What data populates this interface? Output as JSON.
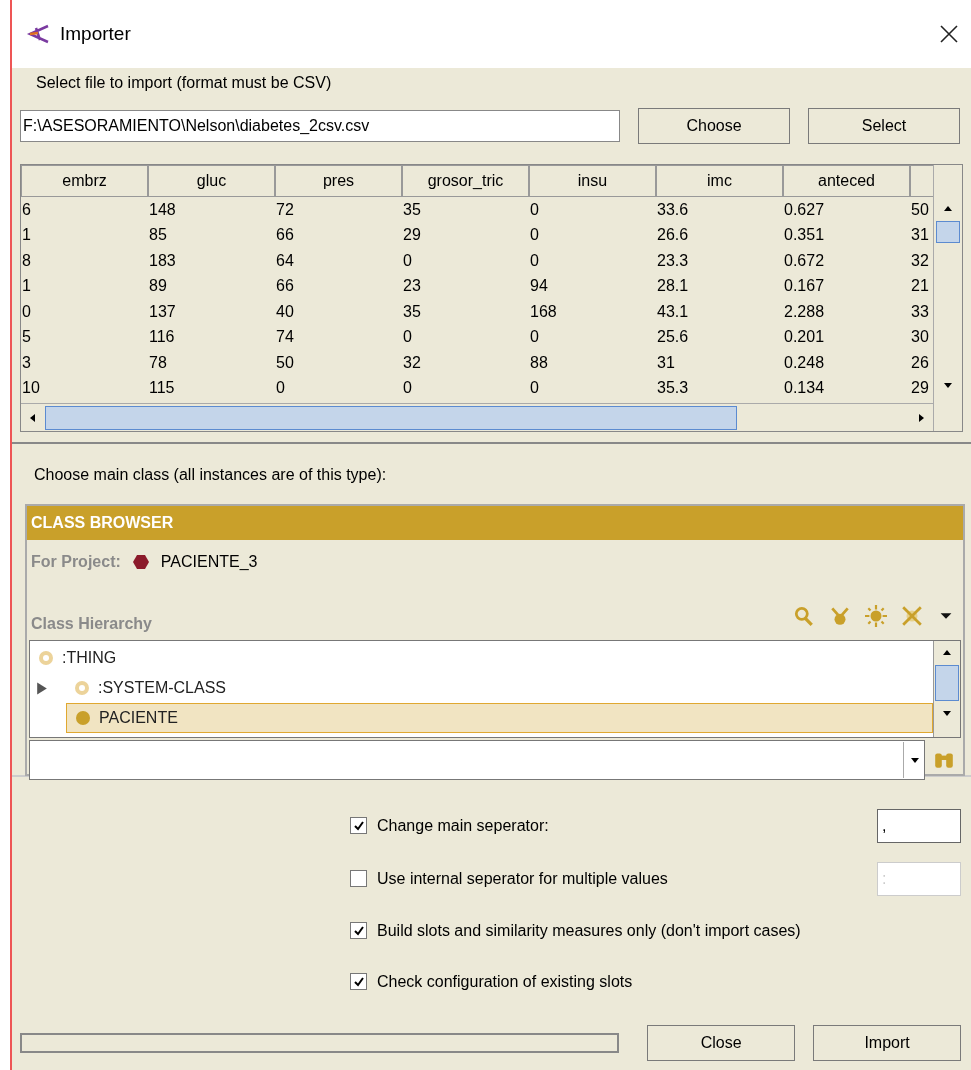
{
  "window": {
    "title": "Importer"
  },
  "file": {
    "label": "Select file to import (format must be CSV)",
    "value": "F:\\ASESORAMIENTO\\Nelson\\diabetes_2csv.csv",
    "buttons": [
      "Choose",
      "Select"
    ]
  },
  "table": {
    "columns": [
      "embrz",
      "gluc",
      "pres",
      "grosor_tric",
      "insu",
      "imc",
      "anteced"
    ],
    "rows": [
      [
        "6",
        "148",
        "72",
        "35",
        "0",
        "33.6",
        "0.627",
        "50"
      ],
      [
        "1",
        "85",
        "66",
        "29",
        "0",
        "26.6",
        "0.351",
        "31"
      ],
      [
        "8",
        "183",
        "64",
        "0",
        "0",
        "23.3",
        "0.672",
        "32"
      ],
      [
        "1",
        "89",
        "66",
        "23",
        "94",
        "28.1",
        "0.167",
        "21"
      ],
      [
        "0",
        "137",
        "40",
        "35",
        "168",
        "43.1",
        "2.288",
        "33"
      ],
      [
        "5",
        "116",
        "74",
        "0",
        "0",
        "25.6",
        "0.201",
        "30"
      ],
      [
        "3",
        "78",
        "50",
        "32",
        "88",
        "31",
        "0.248",
        "26"
      ],
      [
        "10",
        "115",
        "0",
        "0",
        "0",
        "35.3",
        "0.134",
        "29"
      ]
    ]
  },
  "class_label": "Choose main class (all instances are of this type):",
  "class_browser": {
    "title": "CLASS BROWSER",
    "project_label": "For Project:",
    "project": "PACIENTE_3",
    "hierarchy_label": "Class Hierarchy",
    "tree": [
      {
        "label": ":THING",
        "kind": "system",
        "selected": false,
        "children": [
          {
            "label": ":SYSTEM-CLASS",
            "kind": "system",
            "selected": false,
            "expanded": false
          },
          {
            "label": "PACIENTE",
            "kind": "class",
            "selected": true
          }
        ]
      }
    ]
  },
  "options": [
    {
      "label": "Change main seperator:",
      "checked": true,
      "value": ",",
      "disabled": false
    },
    {
      "label": "Use internal seperator for multiple values",
      "checked": false,
      "value": ":",
      "disabled": true
    },
    {
      "label": "Build slots and similarity measures only (don't import cases)",
      "checked": true
    },
    {
      "label": "Check configuration of existing slots",
      "checked": true
    }
  ],
  "buttons": [
    "Close",
    "Import"
  ]
}
